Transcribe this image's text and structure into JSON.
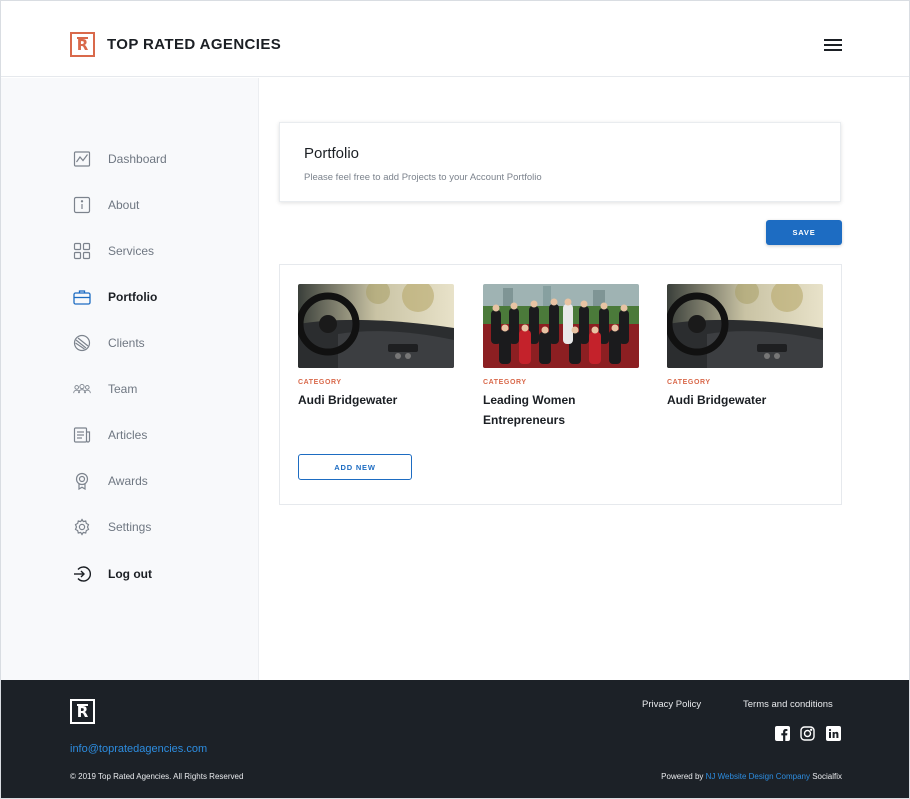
{
  "header": {
    "logo_letter": "R",
    "brand": "TOP RATED AGENCIES"
  },
  "sidebar": {
    "items": [
      {
        "label": "Dashboard",
        "icon": "chart-icon"
      },
      {
        "label": "About",
        "icon": "info-icon"
      },
      {
        "label": "Services",
        "icon": "grid-icon"
      },
      {
        "label": "Portfolio",
        "icon": "briefcase-icon",
        "active": true
      },
      {
        "label": "Clients",
        "icon": "clients-icon"
      },
      {
        "label": "Team",
        "icon": "team-icon"
      },
      {
        "label": "Articles",
        "icon": "articles-icon"
      },
      {
        "label": "Awards",
        "icon": "award-icon"
      },
      {
        "label": "Settings",
        "icon": "gear-icon"
      },
      {
        "label": "Log out",
        "icon": "logout-icon"
      }
    ]
  },
  "main": {
    "title": "Portfolio",
    "subtitle": "Please feel free to add Projects to your Account Portfolio",
    "save_label": "SAVE",
    "add_new_label": "ADD NEW",
    "projects": [
      {
        "category": "CATEGORY",
        "name": "Audi Bridgewater",
        "image": "car-interior"
      },
      {
        "category": "CATEGORY",
        "name": "Leading Women Entrepreneurs",
        "image": "group-photo"
      },
      {
        "category": "CATEGORY",
        "name": "Audi Bridgewater",
        "image": "car-interior"
      }
    ]
  },
  "footer": {
    "logo_letter": "R",
    "email": "info@topratedagencies.com",
    "copyright": "© 2019 Top Rated Agencies. All Rights Reserved",
    "privacy": "Privacy Policy",
    "terms": "Terms and conditions",
    "powered_prefix": "Powered by ",
    "powered_link": "NJ Website Design Company",
    "powered_suffix": " Socialfix"
  },
  "colors": {
    "accent": "#1d6cc2",
    "brand": "#d9694b",
    "footer_bg": "#1c2127"
  }
}
